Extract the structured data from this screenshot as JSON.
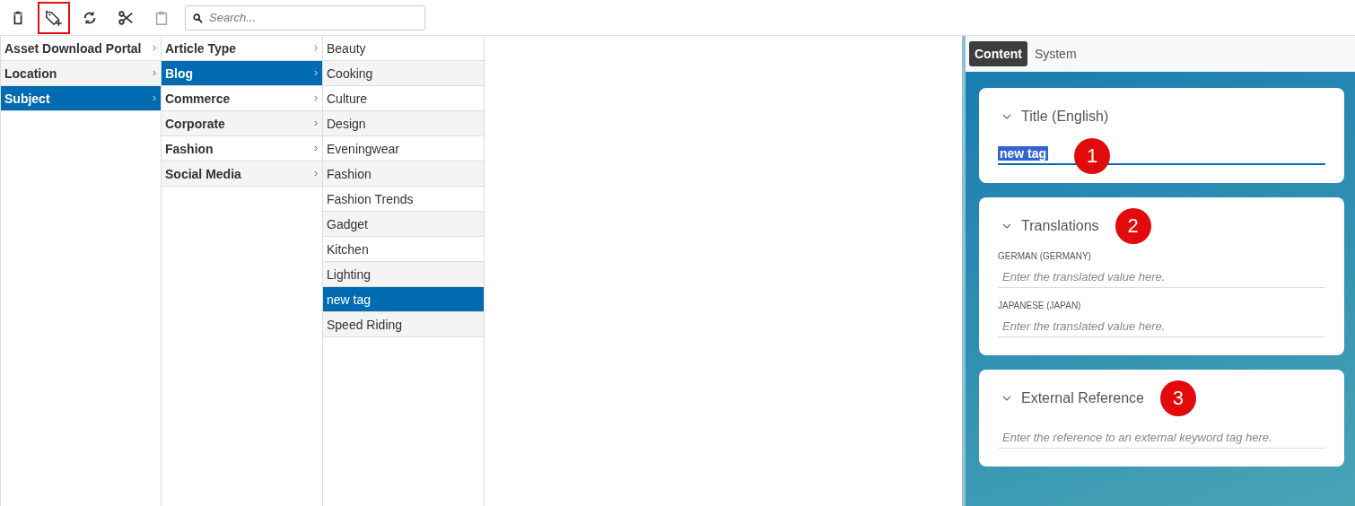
{
  "toolbar": {
    "tools": [
      {
        "kind": "trash",
        "highlighted": false,
        "disabled": false
      },
      {
        "kind": "tag-add",
        "highlighted": true,
        "disabled": false
      },
      {
        "kind": "sync",
        "highlighted": false,
        "disabled": false
      },
      {
        "kind": "cut",
        "highlighted": false,
        "disabled": false
      },
      {
        "kind": "paste",
        "highlighted": false,
        "disabled": true
      }
    ],
    "search": {
      "placeholder": "Search..."
    }
  },
  "columns": [
    {
      "items": [
        {
          "label": "Asset Download Portal",
          "expandable": true,
          "selected": false
        },
        {
          "label": "Location",
          "expandable": true,
          "selected": false
        },
        {
          "label": "Subject",
          "expandable": true,
          "selected": true
        }
      ]
    },
    {
      "items": [
        {
          "label": "Article Type",
          "expandable": true,
          "selected": false
        },
        {
          "label": "Blog",
          "expandable": true,
          "selected": true
        },
        {
          "label": "Commerce",
          "expandable": true,
          "selected": false
        },
        {
          "label": "Corporate",
          "expandable": true,
          "selected": false
        },
        {
          "label": "Fashion",
          "expandable": true,
          "selected": false
        },
        {
          "label": "Social Media",
          "expandable": true,
          "selected": false
        }
      ]
    },
    {
      "items": [
        {
          "label": "Beauty",
          "expandable": false,
          "selected": false
        },
        {
          "label": "Cooking",
          "expandable": false,
          "selected": false
        },
        {
          "label": "Culture",
          "expandable": false,
          "selected": false
        },
        {
          "label": "Design",
          "expandable": false,
          "selected": false
        },
        {
          "label": "Eveningwear",
          "expandable": false,
          "selected": false
        },
        {
          "label": "Fashion",
          "expandable": false,
          "selected": false
        },
        {
          "label": "Fashion Trends",
          "expandable": false,
          "selected": false
        },
        {
          "label": "Gadget",
          "expandable": false,
          "selected": false
        },
        {
          "label": "Kitchen",
          "expandable": false,
          "selected": false
        },
        {
          "label": "Lighting",
          "expandable": false,
          "selected": false
        },
        {
          "label": "new tag",
          "expandable": false,
          "selected": true
        },
        {
          "label": "Speed Riding",
          "expandable": false,
          "selected": false
        }
      ]
    }
  ],
  "panel": {
    "tabs": [
      {
        "label": "Content",
        "selected": true
      },
      {
        "label": "System",
        "selected": false
      }
    ],
    "sections": [
      {
        "kind": "title",
        "title": "Title (English)",
        "badge": "1",
        "fields": [
          {
            "value": "new tag",
            "text_selected": true
          }
        ]
      },
      {
        "kind": "translations",
        "title": "Translations",
        "badge": "2",
        "fields": [
          {
            "label": "GERMAN (GERMANY)",
            "placeholder": "Enter the translated value here."
          },
          {
            "label": "JAPANESE (JAPAN)",
            "placeholder": "Enter the translated value here."
          }
        ]
      },
      {
        "kind": "external",
        "title": "External Reference",
        "badge": "3",
        "fields": [
          {
            "placeholder": "Enter the reference to an external keyword tag here."
          }
        ]
      }
    ]
  }
}
